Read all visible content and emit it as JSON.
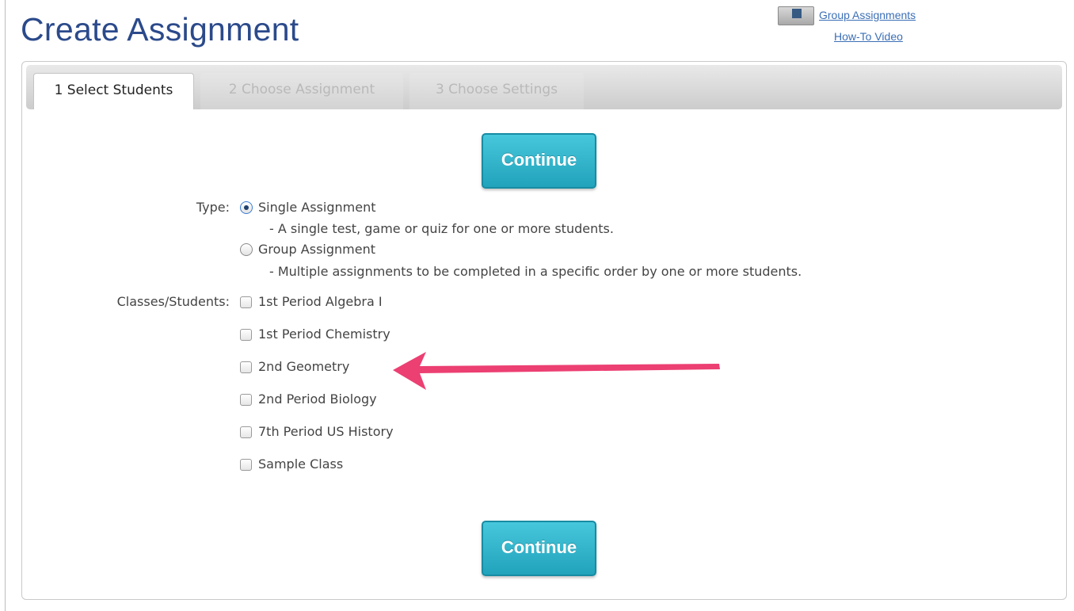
{
  "page": {
    "title": "Create Assignment"
  },
  "help_links": {
    "line1": "Group Assignments",
    "line2": "How-To Video"
  },
  "tabs": [
    {
      "label": "1 Select Students",
      "active": true
    },
    {
      "label": "2 Choose Assignment",
      "active": false
    },
    {
      "label": "3 Choose Settings",
      "active": false
    }
  ],
  "buttons": {
    "continue_top": "Continue",
    "continue_bottom": "Continue"
  },
  "type_field": {
    "label": "Type:",
    "options": [
      {
        "label": "Single Assignment",
        "description": "- A single test, game or quiz for one or more students.",
        "selected": true
      },
      {
        "label": "Group Assignment",
        "description": "- Multiple assignments to be completed in a specific order by one or more students.",
        "selected": false
      }
    ]
  },
  "classes_field": {
    "label": "Classes/Students:",
    "options": [
      {
        "label": "1st Period Algebra I",
        "checked": false
      },
      {
        "label": "1st Period Chemistry",
        "checked": false
      },
      {
        "label": "2nd Geometry",
        "checked": false
      },
      {
        "label": "2nd Period Biology",
        "checked": false
      },
      {
        "label": "7th Period US History",
        "checked": false
      },
      {
        "label": "Sample Class",
        "checked": false
      }
    ]
  },
  "colors": {
    "title": "#2b4a8b",
    "button": "#2bb3cb",
    "annotation_arrow": "#ec3f72",
    "link": "#3b6fb6"
  },
  "annotation": {
    "type": "arrow",
    "points_to": "2nd Geometry"
  }
}
